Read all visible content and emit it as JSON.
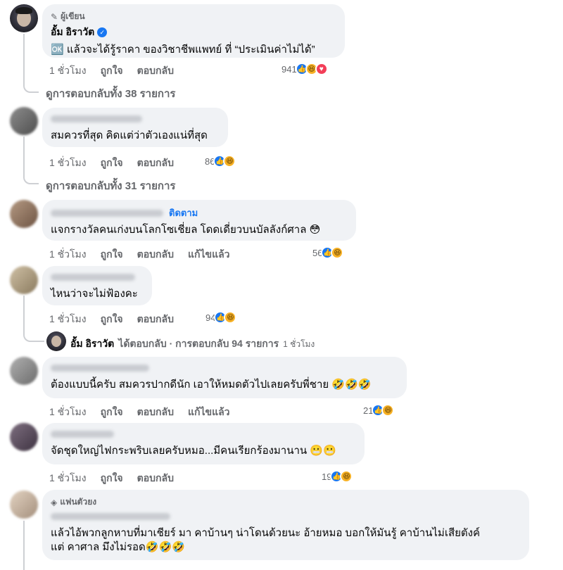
{
  "comments": [
    {
      "badge": "ผู้เขียน",
      "author": "อั้ม อิราวัต",
      "text": "🆗 แล้วจะได้รู้ราคา ของวิชาชีพแพทย์ ที่ “ประเมินค่าไม่ได้”",
      "time": "1 ชั่วโมง",
      "like": "ถูกใจ",
      "reply": "ตอบกลับ",
      "reaction_count": "941",
      "view_replies": "ดูการตอบกลับทั้ง 38 รายการ"
    },
    {
      "text": "สมควรที่สุด คิดแต่ว่าตัวเองแน่ที่สุด",
      "time": "1 ชั่วโมง",
      "like": "ถูกใจ",
      "reply": "ตอบกลับ",
      "reaction_count": "86",
      "view_replies": "ดูการตอบกลับทั้ง 31 รายการ"
    },
    {
      "follow": "ติดตาม",
      "text": "แจกรางวัลคนเก่งบนโลกโซเชี่ยล โดดเดี่ยวบนบัลลังก์ศาล 😳",
      "time": "1 ชั่วโมง",
      "like": "ถูกใจ",
      "reply": "ตอบกลับ",
      "edited": "แก้ไขแล้ว",
      "reaction_count": "56"
    },
    {
      "text": "ไหนว่าจะไม่ฟ้องคะ",
      "time": "1 ชั่วโมง",
      "like": "ถูกใจ",
      "reply": "ตอบกลับ",
      "reaction_count": "94",
      "reply_summary": {
        "author": "อั้ม อิราวัต",
        "action": "ได้ตอบกลับ · การตอบกลับ 94 รายการ",
        "time": "1 ชั่วโมง"
      }
    },
    {
      "text": "ต้องแบบนี้ครับ สมควรปากดีนัก เอาให้หมดตัวไปเลยครับพี่ชาย 🤣🤣🤣",
      "time": "1 ชั่วโมง",
      "like": "ถูกใจ",
      "reply": "ตอบกลับ",
      "edited": "แก้ไขแล้ว",
      "reaction_count": "21"
    },
    {
      "text": "จัดชุดใหญ่ไฟกระพริบเลยครับหมอ...มีคนเรียกร้องมานาน 😬😬",
      "time": "1 ชั่วโมง",
      "like": "ถูกใจ",
      "reply": "ตอบกลับ",
      "reaction_count": "19"
    },
    {
      "badge": "แฟนตัวยง",
      "text_line1": "แล้วไอ้พวกลูกหาบที่มาเชียร์ มา คาบ้านๆ น่าโดนด้วยนะ อ้ายหมอ บอกให้มันรู้ คาบ้านไม่เสียตังค์",
      "text_line2": "แต่ คาศาล มึงไม่รอด🤣🤣🤣"
    }
  ],
  "icons": {
    "pencil": "pencil-icon",
    "verified": "verified-icon",
    "diamond": "diamond-icon",
    "like": "like-reaction-icon",
    "haha": "haha-reaction-icon",
    "love": "love-reaction-icon"
  },
  "colors": {
    "bubble": "#f0f2f5",
    "link": "#1877f2",
    "meta": "#65676b"
  }
}
